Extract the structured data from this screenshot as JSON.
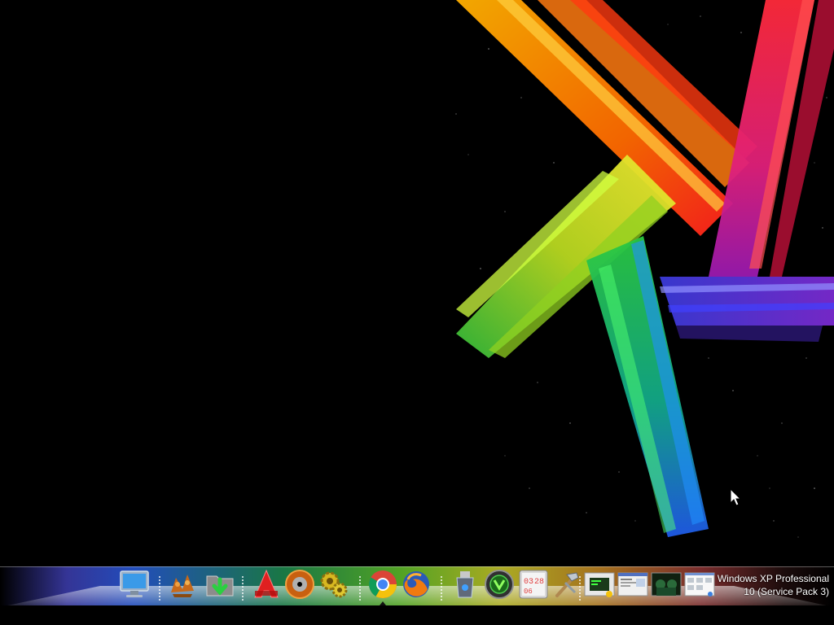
{
  "desktop": {
    "background_color": "#000000",
    "accent_colors": [
      "#ff8a00",
      "#ff2a2a",
      "#d8e020",
      "#1ab84a",
      "#1f6fe0",
      "#6a2ad8",
      "#e0208a"
    ]
  },
  "dock": {
    "items": [
      {
        "icon": "monitor-icon"
      },
      {
        "icon": "recycle-bin-icon"
      },
      {
        "icon": "downloads-folder-icon"
      },
      {
        "icon": "app-a-icon"
      },
      {
        "icon": "disc-burner-icon"
      },
      {
        "icon": "gears-icon"
      },
      {
        "icon": "chrome-icon"
      },
      {
        "icon": "firefox-icon"
      },
      {
        "icon": "usb-stick-icon"
      },
      {
        "icon": "antivirus-icon"
      },
      {
        "icon": "calendar-clock-icon"
      },
      {
        "icon": "tools-icon"
      },
      {
        "icon": "terminal-window-icon"
      },
      {
        "icon": "window-thumbnail-icon"
      },
      {
        "icon": "photo-thumbnail-icon"
      },
      {
        "icon": "document-thumbnail-icon"
      }
    ],
    "clock_widget": {
      "hours": "03",
      "minutes": "28",
      "day": "06"
    }
  },
  "watermark": {
    "line1": "Windows XP Professional",
    "line2": "10 (Service Pack 3)"
  }
}
